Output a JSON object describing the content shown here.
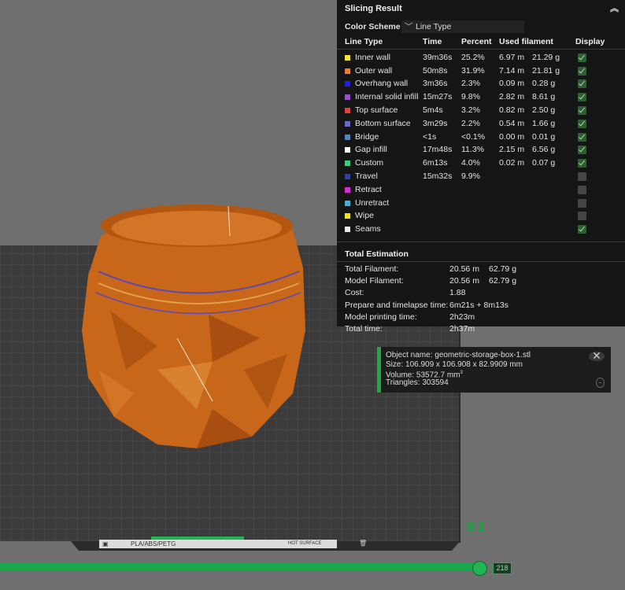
{
  "panel": {
    "title": "Slicing Result",
    "color_scheme_label": "Color Scheme",
    "color_scheme_value": "Line Type",
    "headers": {
      "type": "Line Type",
      "time": "Time",
      "percent": "Percent",
      "filament": "Used filament",
      "display": "Display"
    },
    "rows": [
      {
        "name": "Inner wall",
        "time": "39m36s",
        "pct": "25.2%",
        "m": "6.97 m",
        "g": "21.29 g",
        "color": "#f0e040",
        "shown": true
      },
      {
        "name": "Outer wall",
        "time": "50m8s",
        "pct": "31.9%",
        "m": "7.14 m",
        "g": "21.81 g",
        "color": "#f07b2a",
        "shown": true
      },
      {
        "name": "Overhang wall",
        "time": "3m36s",
        "pct": "2.3%",
        "m": "0.09 m",
        "g": "0.28 g",
        "color": "#2020d8",
        "shown": true
      },
      {
        "name": "Internal solid infill",
        "time": "15m27s",
        "pct": "9.8%",
        "m": "2.82 m",
        "g": "8.61 g",
        "color": "#9a4fc8",
        "shown": true
      },
      {
        "name": "Top surface",
        "time": "5m4s",
        "pct": "3.2%",
        "m": "0.82 m",
        "g": "2.50 g",
        "color": "#e04040",
        "shown": true
      },
      {
        "name": "Bottom surface",
        "time": "3m29s",
        "pct": "2.2%",
        "m": "0.54 m",
        "g": "1.66 g",
        "color": "#6a68c8",
        "shown": true
      },
      {
        "name": "Bridge",
        "time": "<1s",
        "pct": "<0.1%",
        "m": "0.00 m",
        "g": "0.01 g",
        "color": "#4a86c8",
        "shown": true
      },
      {
        "name": "Gap infill",
        "time": "17m48s",
        "pct": "11.3%",
        "m": "2.15 m",
        "g": "6.56 g",
        "color": "#ffffff",
        "shown": true
      },
      {
        "name": "Custom",
        "time": "6m13s",
        "pct": "4.0%",
        "m": "0.02 m",
        "g": "0.07 g",
        "color": "#40c878",
        "shown": true
      },
      {
        "name": "Travel",
        "time": "15m32s",
        "pct": "9.9%",
        "m": "",
        "g": "",
        "color": "#3040a0",
        "shown": false
      },
      {
        "name": "Retract",
        "time": "",
        "pct": "",
        "m": "",
        "g": "",
        "color": "#d030d0",
        "shown": false
      },
      {
        "name": "Unretract",
        "time": "",
        "pct": "",
        "m": "",
        "g": "",
        "color": "#40b0d8",
        "shown": false
      },
      {
        "name": "Wipe",
        "time": "",
        "pct": "",
        "m": "",
        "g": "",
        "color": "#f0e020",
        "shown": false
      },
      {
        "name": "Seams",
        "time": "",
        "pct": "",
        "m": "",
        "g": "",
        "color": "#e8e8e8",
        "shown": true
      }
    ],
    "total_title": "Total Estimation",
    "totals": [
      {
        "label": "Total Filament:",
        "a": "20.56 m",
        "b": "62.79 g"
      },
      {
        "label": "Model Filament:",
        "a": "20.56 m",
        "b": "62.79 g"
      },
      {
        "label": "Cost:",
        "a": "1.88",
        "b": ""
      },
      {
        "label": "Prepare and timelapse time:",
        "a": "6m21s + 8m13s",
        "b": ""
      },
      {
        "label": "Model printing time:",
        "a": "2h23m",
        "b": ""
      },
      {
        "label": "Total time:",
        "a": "2h37m",
        "b": ""
      }
    ]
  },
  "object_info": {
    "name": "Object name: geometric-storage-box-1.stl",
    "size": "Size: 106.909 x 106.908 x 82.9909 mm",
    "volume": "Volume: 53572.7 mm",
    "volume_sup": "3",
    "triangles": "Triangles: 303594"
  },
  "plate": {
    "filament_label": "PLA/ABS/PETG",
    "surface_label": "HOT SURFACE"
  },
  "layer_indicator": "01",
  "slider_value": "218",
  "colors": {
    "accent": "#1fb552",
    "model": "#c8661a"
  }
}
